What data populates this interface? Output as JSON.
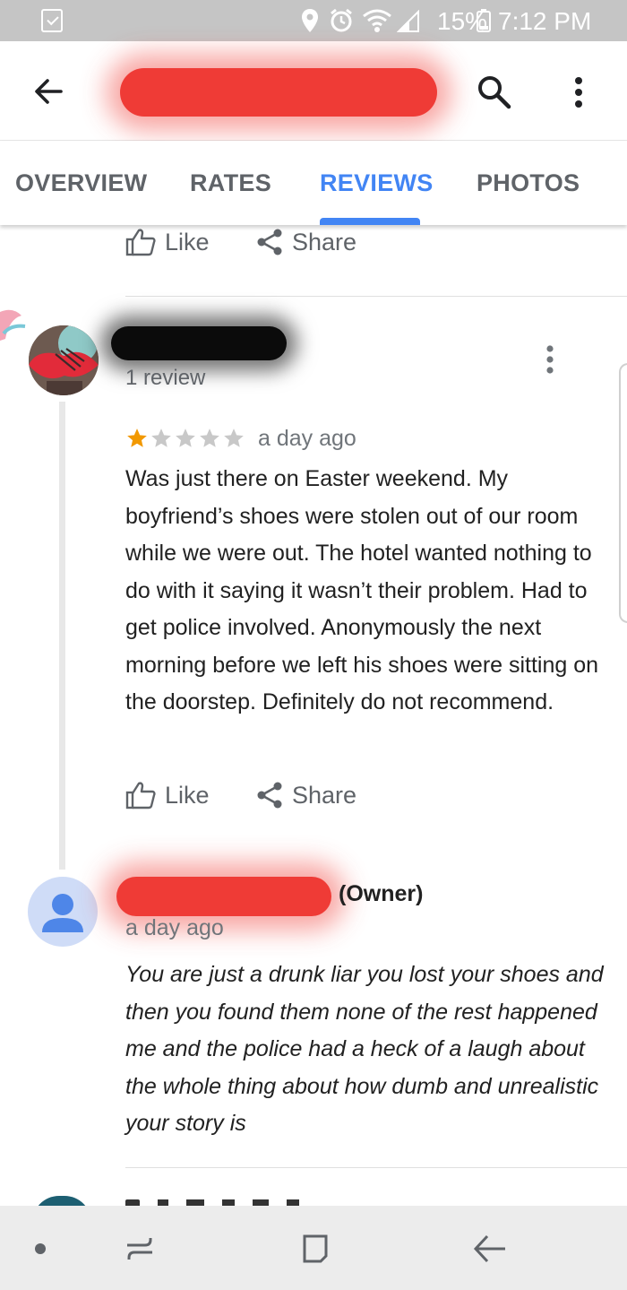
{
  "status_bar": {
    "battery": "15%",
    "time": "7:12 PM"
  },
  "app_bar": {
    "back_icon": "arrow-left-icon",
    "search_icon": "search-icon",
    "more_icon": "more-vert-icon"
  },
  "tabs": [
    {
      "label": "OVERVIEW",
      "active": false
    },
    {
      "label": "RATES",
      "active": false
    },
    {
      "label": "REVIEWS",
      "active": true
    },
    {
      "label": "PHOTOS",
      "active": false
    }
  ],
  "actions": {
    "like": "Like",
    "share": "Share"
  },
  "review": {
    "review_count": "1 review",
    "rating": 1,
    "rating_max": 5,
    "time": "a day ago",
    "text": "Was just there on Easter weekend. My boyfriend’s shoes were stolen out of our room while we were out. The hotel wanted nothing to do with it saying it wasn’t their problem. Had to get police involved. Anonymously the next morning before we left his shoes were sitting on the doorstep. Definitely do not recommend."
  },
  "owner_reply": {
    "role": "(Owner)",
    "time": "a day ago",
    "text": "You are just a drunk liar you lost your shoes and then you found them none of the rest happened me and the police had a heck of a laugh about the whole thing about how dumb and unrealistic your story is"
  },
  "colors": {
    "accent": "#4285f4",
    "star_filled": "#f29900",
    "star_empty": "#c8c8c8",
    "redaction_red": "#ef3b36"
  }
}
